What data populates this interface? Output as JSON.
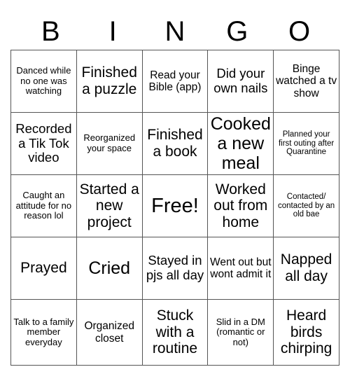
{
  "card": {
    "title_letters": [
      "B",
      "I",
      "N",
      "G",
      "O"
    ],
    "background_color": "#ffffff",
    "text_color": "#000000",
    "border_color": "#555555",
    "rows": [
      [
        {
          "text": "Danced while no one was watching",
          "size": "fs-s"
        },
        {
          "text": "Finished a puzzle",
          "size": "fs-xl"
        },
        {
          "text": "Read your Bible (app)",
          "size": "fs-m"
        },
        {
          "text": "Did your own nails",
          "size": "fs-l"
        },
        {
          "text": "Binge watched a tv show",
          "size": "fs-m"
        }
      ],
      [
        {
          "text": "Recorded a Tik Tok video",
          "size": "fs-l"
        },
        {
          "text": "Reorganized your space",
          "size": "fs-s"
        },
        {
          "text": "Finished a book",
          "size": "fs-xl"
        },
        {
          "text": "Cooked a new meal",
          "size": "fs-xxl"
        },
        {
          "text": "Planned your first outing after Quarantine",
          "size": "fs-xs"
        }
      ],
      [
        {
          "text": "Caught an attitude for no reason lol",
          "size": "fs-s"
        },
        {
          "text": "Started a new project",
          "size": "fs-xl"
        },
        {
          "text": "Free!",
          "size": "fs-free"
        },
        {
          "text": "Worked out from home",
          "size": "fs-xl"
        },
        {
          "text": "Contacted/ contacted by an old bae",
          "size": "fs-xs"
        }
      ],
      [
        {
          "text": "Prayed",
          "size": "fs-xl"
        },
        {
          "text": "Cried",
          "size": "fs-xxl"
        },
        {
          "text": "Stayed in pjs all day",
          "size": "fs-l"
        },
        {
          "text": "Went out but wont admit it",
          "size": "fs-m"
        },
        {
          "text": "Napped all day",
          "size": "fs-xl"
        }
      ],
      [
        {
          "text": "Talk to a family member everyday",
          "size": "fs-s"
        },
        {
          "text": "Organized closet",
          "size": "fs-m"
        },
        {
          "text": "Stuck with a routine",
          "size": "fs-xl"
        },
        {
          "text": "Slid in a DM (romantic or not)",
          "size": "fs-s"
        },
        {
          "text": "Heard birds chirping",
          "size": "fs-xl"
        }
      ]
    ]
  }
}
